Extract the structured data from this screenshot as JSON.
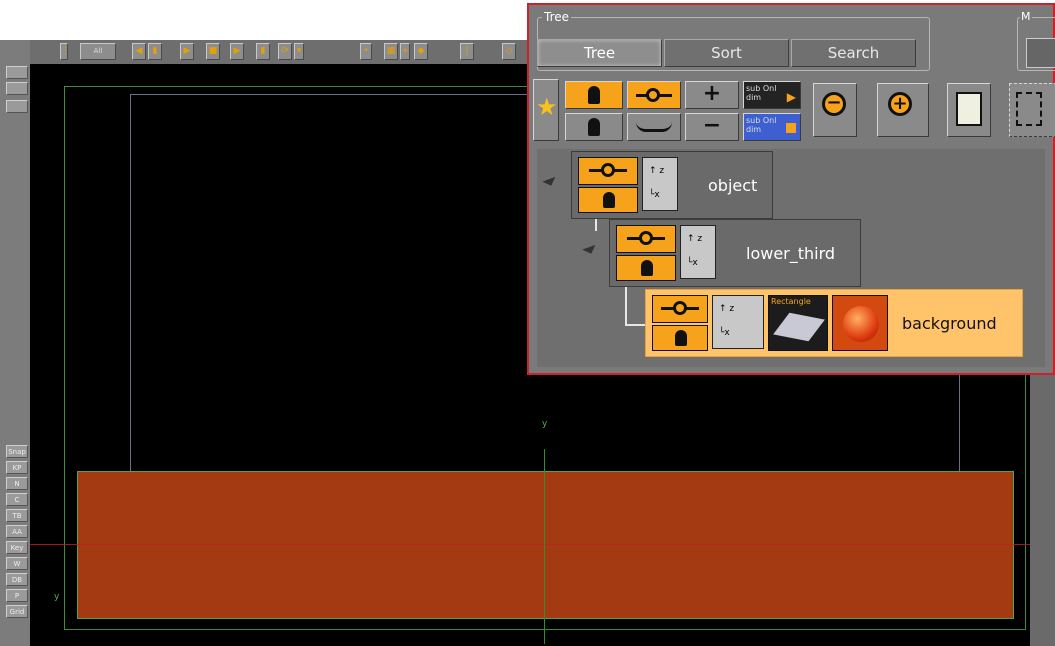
{
  "left_toolbar": {
    "buttons": [
      "Snap",
      "KP",
      "N",
      "C",
      "TB",
      "AA",
      "Key",
      "W",
      "DB",
      "P",
      "Grid"
    ]
  },
  "top_toolbar": {
    "all_label": "All"
  },
  "viewport": {
    "axis_y_label": "y",
    "colors": {
      "lower_third": "#a33a12",
      "safe_frame": "#3f8a3f",
      "title_frame": "#6e6e8c"
    }
  },
  "tree_panel": {
    "group_title": "Tree",
    "side_group_title": "M",
    "tabs": [
      {
        "label": "Tree",
        "active": true
      },
      {
        "label": "Sort",
        "active": false
      },
      {
        "label": "Search",
        "active": false
      }
    ],
    "tools": {
      "add_label": "+",
      "remove_label": "−",
      "sub_online_label": "sub Onl dim",
      "rect_chip_label": "Rectangle"
    },
    "nodes": [
      {
        "name": "object",
        "selected": false
      },
      {
        "name": "lower_third",
        "selected": false
      },
      {
        "name": "background",
        "selected": true
      }
    ]
  }
}
